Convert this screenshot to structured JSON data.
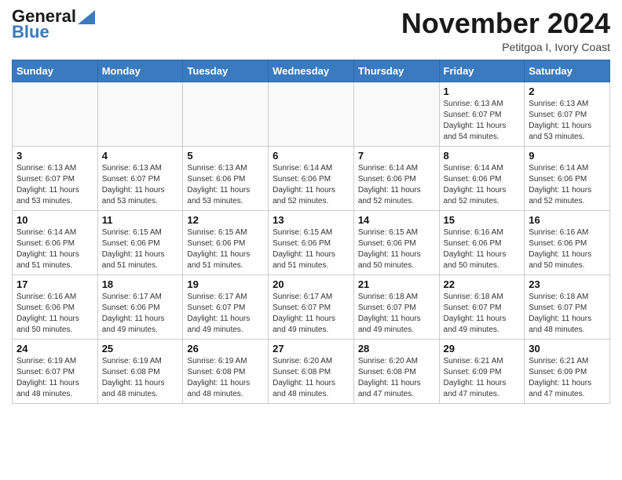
{
  "header": {
    "logo_line1": "General",
    "logo_line2": "Blue",
    "month_title": "November 2024",
    "location": "Petitgoa I, Ivory Coast"
  },
  "weekdays": [
    "Sunday",
    "Monday",
    "Tuesday",
    "Wednesday",
    "Thursday",
    "Friday",
    "Saturday"
  ],
  "weeks": [
    [
      {
        "day": "",
        "info": ""
      },
      {
        "day": "",
        "info": ""
      },
      {
        "day": "",
        "info": ""
      },
      {
        "day": "",
        "info": ""
      },
      {
        "day": "",
        "info": ""
      },
      {
        "day": "1",
        "info": "Sunrise: 6:13 AM\nSunset: 6:07 PM\nDaylight: 11 hours\nand 54 minutes."
      },
      {
        "day": "2",
        "info": "Sunrise: 6:13 AM\nSunset: 6:07 PM\nDaylight: 11 hours\nand 53 minutes."
      }
    ],
    [
      {
        "day": "3",
        "info": "Sunrise: 6:13 AM\nSunset: 6:07 PM\nDaylight: 11 hours\nand 53 minutes."
      },
      {
        "day": "4",
        "info": "Sunrise: 6:13 AM\nSunset: 6:07 PM\nDaylight: 11 hours\nand 53 minutes."
      },
      {
        "day": "5",
        "info": "Sunrise: 6:13 AM\nSunset: 6:06 PM\nDaylight: 11 hours\nand 53 minutes."
      },
      {
        "day": "6",
        "info": "Sunrise: 6:14 AM\nSunset: 6:06 PM\nDaylight: 11 hours\nand 52 minutes."
      },
      {
        "day": "7",
        "info": "Sunrise: 6:14 AM\nSunset: 6:06 PM\nDaylight: 11 hours\nand 52 minutes."
      },
      {
        "day": "8",
        "info": "Sunrise: 6:14 AM\nSunset: 6:06 PM\nDaylight: 11 hours\nand 52 minutes."
      },
      {
        "day": "9",
        "info": "Sunrise: 6:14 AM\nSunset: 6:06 PM\nDaylight: 11 hours\nand 52 minutes."
      }
    ],
    [
      {
        "day": "10",
        "info": "Sunrise: 6:14 AM\nSunset: 6:06 PM\nDaylight: 11 hours\nand 51 minutes."
      },
      {
        "day": "11",
        "info": "Sunrise: 6:15 AM\nSunset: 6:06 PM\nDaylight: 11 hours\nand 51 minutes."
      },
      {
        "day": "12",
        "info": "Sunrise: 6:15 AM\nSunset: 6:06 PM\nDaylight: 11 hours\nand 51 minutes."
      },
      {
        "day": "13",
        "info": "Sunrise: 6:15 AM\nSunset: 6:06 PM\nDaylight: 11 hours\nand 51 minutes."
      },
      {
        "day": "14",
        "info": "Sunrise: 6:15 AM\nSunset: 6:06 PM\nDaylight: 11 hours\nand 50 minutes."
      },
      {
        "day": "15",
        "info": "Sunrise: 6:16 AM\nSunset: 6:06 PM\nDaylight: 11 hours\nand 50 minutes."
      },
      {
        "day": "16",
        "info": "Sunrise: 6:16 AM\nSunset: 6:06 PM\nDaylight: 11 hours\nand 50 minutes."
      }
    ],
    [
      {
        "day": "17",
        "info": "Sunrise: 6:16 AM\nSunset: 6:06 PM\nDaylight: 11 hours\nand 50 minutes."
      },
      {
        "day": "18",
        "info": "Sunrise: 6:17 AM\nSunset: 6:06 PM\nDaylight: 11 hours\nand 49 minutes."
      },
      {
        "day": "19",
        "info": "Sunrise: 6:17 AM\nSunset: 6:07 PM\nDaylight: 11 hours\nand 49 minutes."
      },
      {
        "day": "20",
        "info": "Sunrise: 6:17 AM\nSunset: 6:07 PM\nDaylight: 11 hours\nand 49 minutes."
      },
      {
        "day": "21",
        "info": "Sunrise: 6:18 AM\nSunset: 6:07 PM\nDaylight: 11 hours\nand 49 minutes."
      },
      {
        "day": "22",
        "info": "Sunrise: 6:18 AM\nSunset: 6:07 PM\nDaylight: 11 hours\nand 49 minutes."
      },
      {
        "day": "23",
        "info": "Sunrise: 6:18 AM\nSunset: 6:07 PM\nDaylight: 11 hours\nand 48 minutes."
      }
    ],
    [
      {
        "day": "24",
        "info": "Sunrise: 6:19 AM\nSunset: 6:07 PM\nDaylight: 11 hours\nand 48 minutes."
      },
      {
        "day": "25",
        "info": "Sunrise: 6:19 AM\nSunset: 6:08 PM\nDaylight: 11 hours\nand 48 minutes."
      },
      {
        "day": "26",
        "info": "Sunrise: 6:19 AM\nSunset: 6:08 PM\nDaylight: 11 hours\nand 48 minutes."
      },
      {
        "day": "27",
        "info": "Sunrise: 6:20 AM\nSunset: 6:08 PM\nDaylight: 11 hours\nand 48 minutes."
      },
      {
        "day": "28",
        "info": "Sunrise: 6:20 AM\nSunset: 6:08 PM\nDaylight: 11 hours\nand 47 minutes."
      },
      {
        "day": "29",
        "info": "Sunrise: 6:21 AM\nSunset: 6:09 PM\nDaylight: 11 hours\nand 47 minutes."
      },
      {
        "day": "30",
        "info": "Sunrise: 6:21 AM\nSunset: 6:09 PM\nDaylight: 11 hours\nand 47 minutes."
      }
    ]
  ]
}
